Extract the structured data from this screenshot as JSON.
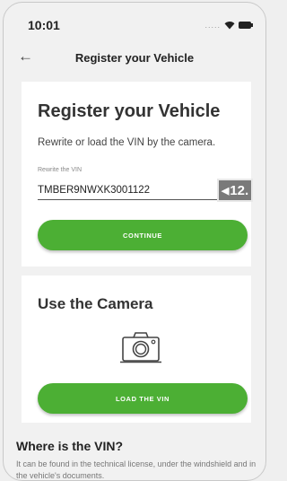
{
  "status_bar": {
    "time": "10:01"
  },
  "app_bar": {
    "back_icon": "arrow-left-icon",
    "title": "Register your Vehicle"
  },
  "register_card": {
    "title": "Register your Vehicle",
    "subtitle": "Rewrite or load the VIN by the camera.",
    "field_label": "Rewrite the VIN",
    "vin_value": "TMBER9NWXK3001122",
    "badge": "12.",
    "continue_label": "CONTINUE"
  },
  "camera_card": {
    "title": "Use the Camera",
    "icon": "camera-icon",
    "load_label": "LOAD THE VIN"
  },
  "help": {
    "title": "Where is the VIN?",
    "text": "It can be found in the technical license, under the windshield and in the vehicle's documents."
  },
  "colors": {
    "accent": "#4caf34",
    "background": "#f1f1f1",
    "card": "#ffffff"
  }
}
